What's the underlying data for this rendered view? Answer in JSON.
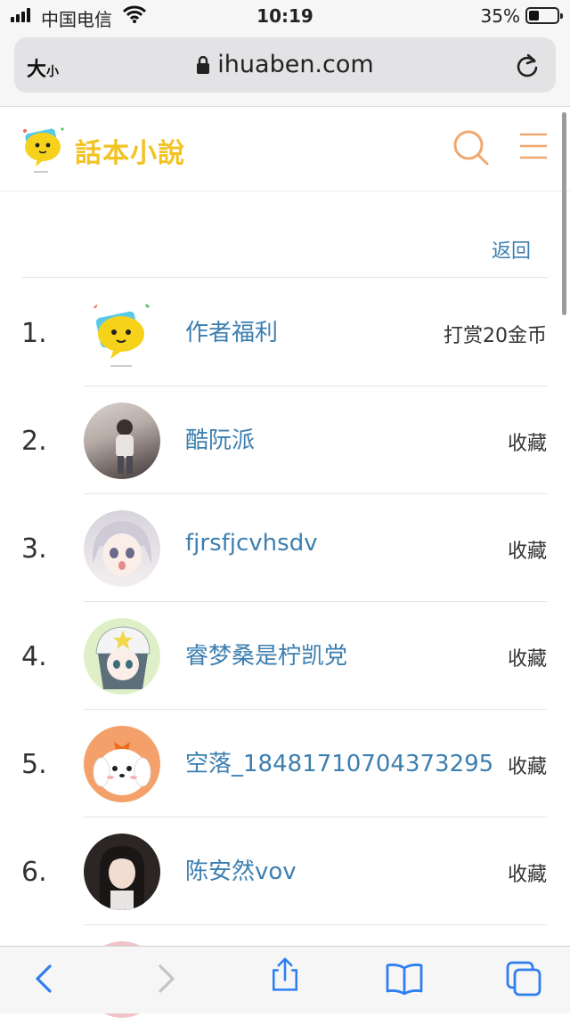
{
  "status": {
    "carrier": "中国电信",
    "time": "10:19",
    "battery": "35%",
    "battery_level": 0.35
  },
  "browser": {
    "text_size_big": "大",
    "text_size_small": "小",
    "url": "ihuaben.com"
  },
  "site": {
    "logo_text": "話本小說"
  },
  "nav": {
    "back": "返回"
  },
  "rows": [
    {
      "rank": "1.",
      "name": "作者福利",
      "action": "打赏20金币"
    },
    {
      "rank": "2.",
      "name": "酷阮派",
      "action": "收藏"
    },
    {
      "rank": "3.",
      "name": "fjrsfjcvhsdv",
      "action": "收藏"
    },
    {
      "rank": "4.",
      "name": "睿梦桑是柠凯党",
      "action": "收藏"
    },
    {
      "rank": "5.",
      "name": "空落_18481710704373295",
      "action": "收藏"
    },
    {
      "rank": "6.",
      "name": "陈安然vov",
      "action": "收藏"
    }
  ],
  "colors": {
    "link": "#3c7fb0",
    "logo": "#f2c322",
    "accent_icons": "#f0a870",
    "ios_blue": "#2f7ff0"
  },
  "icons": [
    "signal-icon",
    "wifi-icon",
    "battery-icon",
    "lock-icon",
    "reload-icon",
    "search-icon",
    "menu-icon",
    "back-arrow-icon",
    "forward-arrow-icon",
    "share-icon",
    "bookmarks-icon",
    "tabs-icon"
  ]
}
